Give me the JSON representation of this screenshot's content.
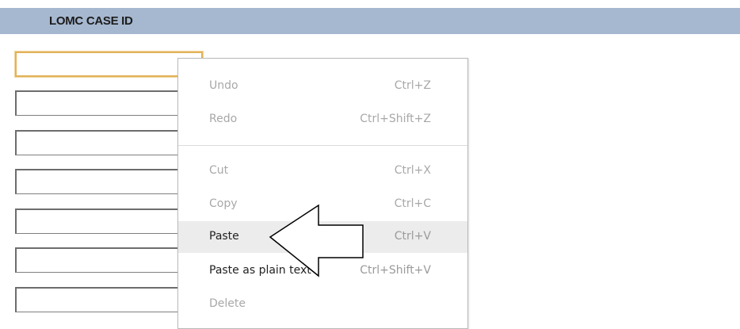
{
  "header": {
    "title": "LOMC CASE ID"
  },
  "inputs": [
    {
      "value": "",
      "focused": true
    },
    {
      "value": ""
    },
    {
      "value": ""
    },
    {
      "value": ""
    },
    {
      "value": ""
    },
    {
      "value": ""
    },
    {
      "value": ""
    }
  ],
  "context_menu": {
    "items": [
      {
        "label": "Undo",
        "shortcut": "Ctrl+Z",
        "enabled": false
      },
      {
        "label": "Redo",
        "shortcut": "Ctrl+Shift+Z",
        "enabled": false
      },
      {
        "label": "Cut",
        "shortcut": "Ctrl+X",
        "enabled": false
      },
      {
        "label": "Copy",
        "shortcut": "Ctrl+C",
        "enabled": false
      },
      {
        "label": "Paste",
        "shortcut": "Ctrl+V",
        "enabled": true,
        "highlighted": true
      },
      {
        "label": "Paste as plain text",
        "shortcut": "Ctrl+Shift+V",
        "enabled": true
      },
      {
        "label": "Delete",
        "shortcut": "",
        "enabled": false
      }
    ]
  },
  "annotation": {
    "icon": "pointer-arrow-icon",
    "points_to": "Paste",
    "stroke": "#000000",
    "fill": "#ffffff"
  },
  "colors": {
    "header_bg": "#a6b8d0",
    "focus_border": "#e2b25a",
    "menu_highlight": "#ececec",
    "disabled_text": "#a8a8a8"
  }
}
